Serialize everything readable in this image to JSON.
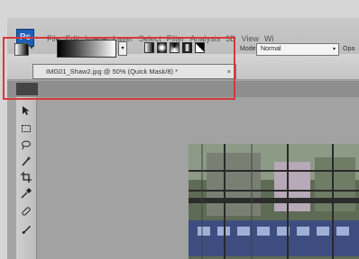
{
  "menubar": {
    "logo": "Ps",
    "items": [
      "File",
      "Edit",
      "Image",
      "Layer",
      "Select",
      "Filter",
      "Analysis",
      "3D",
      "View",
      "Wi"
    ]
  },
  "options": {
    "mode_label": "Mode:",
    "mode_value": "Normal",
    "opacity_label": "Opa"
  },
  "document": {
    "tab_title": "IMG01_Shaw2.jpg @ 50% (Quick Mask/8) *",
    "close": "×"
  },
  "icons": {
    "logo": "photoshop-logo",
    "tools": [
      "move-icon",
      "marquee-icon",
      "lasso-icon",
      "magic-wand-icon",
      "crop-icon",
      "eyedropper-icon",
      "healing-brush-icon",
      "brush-icon"
    ]
  },
  "colors": {
    "highlight": "#d43a3a",
    "logo": "#1f5fb4"
  }
}
